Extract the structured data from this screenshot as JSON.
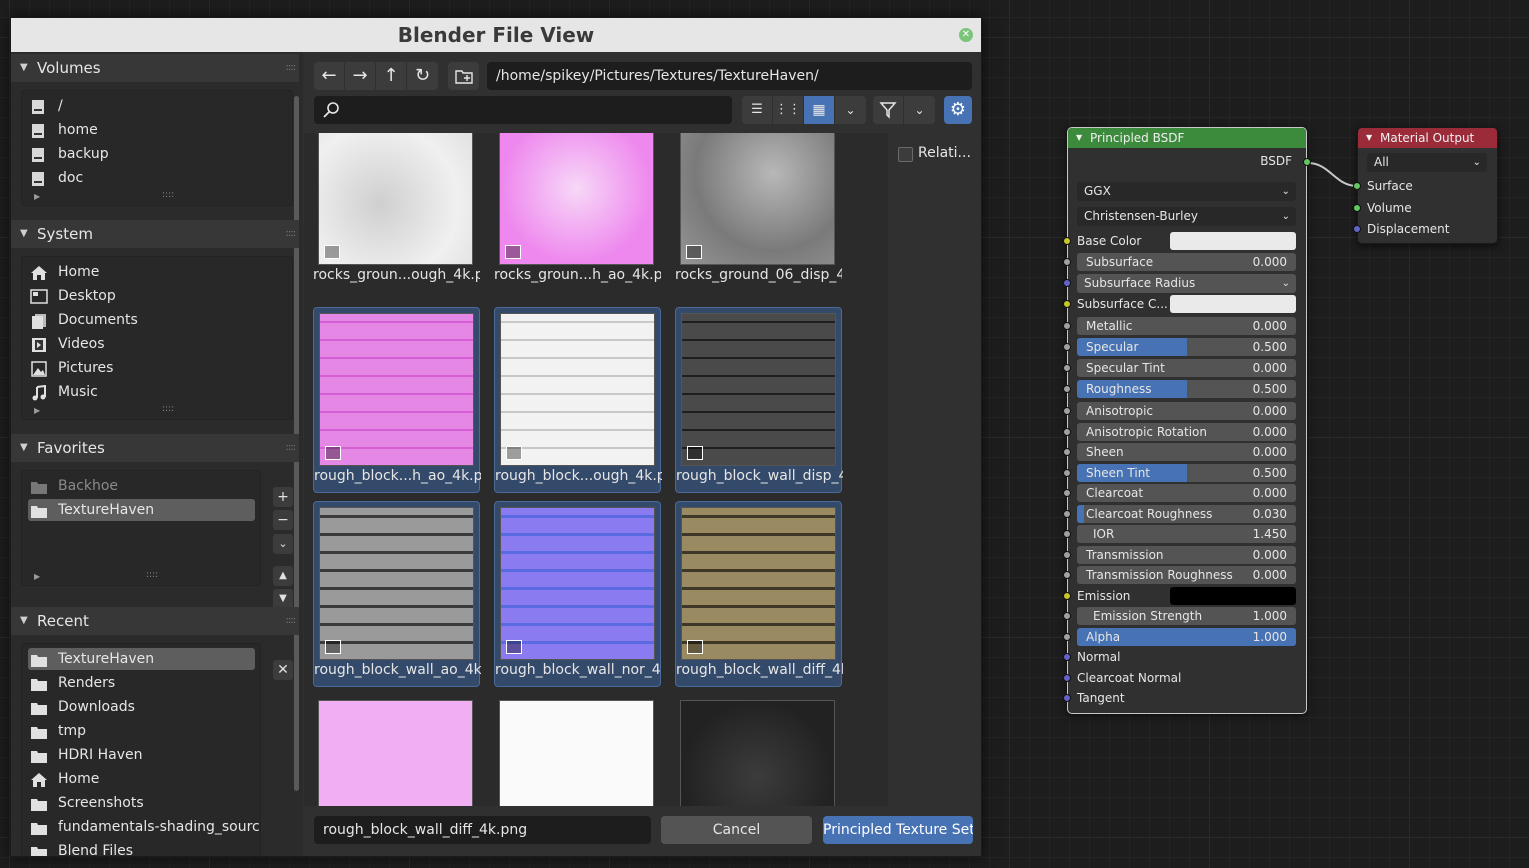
{
  "dialog": {
    "title": "Blender File View",
    "path": "/home/spikey/Pictures/Textures/TextureHaven/",
    "filename": "rough_block_wall_diff_4k.png",
    "cancel_label": "Cancel",
    "confirm_label": "Principled Texture Set...",
    "relative_label": "Relati..."
  },
  "sidebar": {
    "volumes": {
      "title": "Volumes",
      "items": [
        "/",
        "home",
        "backup",
        "doc"
      ]
    },
    "system": {
      "title": "System",
      "items": [
        "Home",
        "Desktop",
        "Documents",
        "Videos",
        "Pictures",
        "Music"
      ]
    },
    "favorites": {
      "title": "Favorites",
      "items": [
        "Backhoe",
        "TextureHaven"
      ]
    },
    "recent": {
      "title": "Recent",
      "items": [
        "TextureHaven",
        "Renders",
        "Downloads",
        "tmp",
        "HDRI Haven",
        "Home",
        "Screenshots",
        "fundamentals-shading_sourc...",
        "Blend Files"
      ]
    }
  },
  "files": [
    {
      "name": "rocks_groun...ough_4k.png",
      "selected": false
    },
    {
      "name": "rocks_groun...h_ao_4k.png",
      "selected": false
    },
    {
      "name": "rocks_ground_06_disp_4...",
      "selected": false
    },
    {
      "name": "rough_block...h_ao_4k.png",
      "selected": true
    },
    {
      "name": "rough_block...ough_4k.png",
      "selected": true
    },
    {
      "name": "rough_block_wall_disp_4k",
      "selected": true
    },
    {
      "name": "rough_block_wall_ao_4k....",
      "selected": true
    },
    {
      "name": "rough_block_wall_nor_4k....",
      "selected": true
    },
    {
      "name": "rough_block_wall_diff_4k....",
      "selected": true
    },
    {
      "name": "",
      "selected": false
    },
    {
      "name": "",
      "selected": false
    },
    {
      "name": "",
      "selected": false
    }
  ],
  "principled": {
    "title": "Principled BSDF",
    "output": "BSDF",
    "distribution": "GGX",
    "subsurface_method": "Christensen-Burley",
    "base_color_label": "Base Color",
    "subsurface_radius_label": "Subsurface Radius",
    "subsurface_color_label": "Subsurface C...",
    "emission_label": "Emission",
    "sliders": [
      {
        "label": "Subsurface",
        "value": "0.000",
        "fill": 0
      },
      {
        "label": "Metallic",
        "value": "0.000",
        "fill": 0
      },
      {
        "label": "Specular",
        "value": "0.500",
        "fill": 0.5
      },
      {
        "label": "Specular Tint",
        "value": "0.000",
        "fill": 0
      },
      {
        "label": "Roughness",
        "value": "0.500",
        "fill": 0.5
      },
      {
        "label": "Anisotropic",
        "value": "0.000",
        "fill": 0
      },
      {
        "label": "Anisotropic Rotation",
        "value": "0.000",
        "fill": 0
      },
      {
        "label": "Sheen",
        "value": "0.000",
        "fill": 0
      },
      {
        "label": "Sheen Tint",
        "value": "0.500",
        "fill": 0.5
      },
      {
        "label": "Clearcoat",
        "value": "0.000",
        "fill": 0
      },
      {
        "label": "Clearcoat Roughness",
        "value": "0.030",
        "fill": 0.03
      },
      {
        "label": "IOR",
        "value": "1.450",
        "fill": 0
      },
      {
        "label": "Transmission",
        "value": "0.000",
        "fill": 0
      },
      {
        "label": "Transmission Roughness",
        "value": "0.000",
        "fill": 0
      },
      {
        "label": "Emission Strength",
        "value": "1.000",
        "fill": 0
      },
      {
        "label": "Alpha",
        "value": "1.000",
        "fill": 1
      }
    ],
    "vector_inputs": [
      "Normal",
      "Clearcoat Normal",
      "Tangent"
    ]
  },
  "material_output": {
    "title": "Material Output",
    "target": "All",
    "inputs": [
      "Surface",
      "Volume",
      "Displacement"
    ]
  },
  "colors": {
    "accent": "#4772b3",
    "shader_header": "#3c8a3c",
    "output_header": "#9c2b3a"
  }
}
